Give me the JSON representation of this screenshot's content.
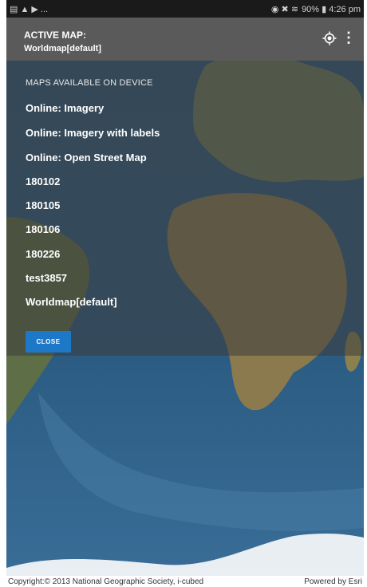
{
  "statusbar": {
    "left_icons": "▤ ▲ ▶ ...",
    "right_text": "90% ▮ 4:26 pm",
    "right_icons": "◉ ✖ ≋"
  },
  "appbar": {
    "title": "ACTIVE MAP:",
    "subtitle": "Worldmap[default]",
    "locate_icon": "locate-icon",
    "more_icon": "more-vert-icon",
    "more_glyph": "⋮"
  },
  "panel": {
    "heading": "MAPS AVAILABLE ON DEVICE",
    "items": [
      "Online: Imagery",
      "Online: Imagery with labels",
      "Online: Open Street Map",
      "180102",
      "180105",
      "180106",
      "180226",
      "test3857",
      "Worldmap[default]"
    ],
    "close_label": "CLOSE",
    "accent": "#1e78c8"
  },
  "footer": {
    "copyright": "Copyright:© 2013 National Geographic Society, i-cubed",
    "powered": "Powered by Esri"
  }
}
